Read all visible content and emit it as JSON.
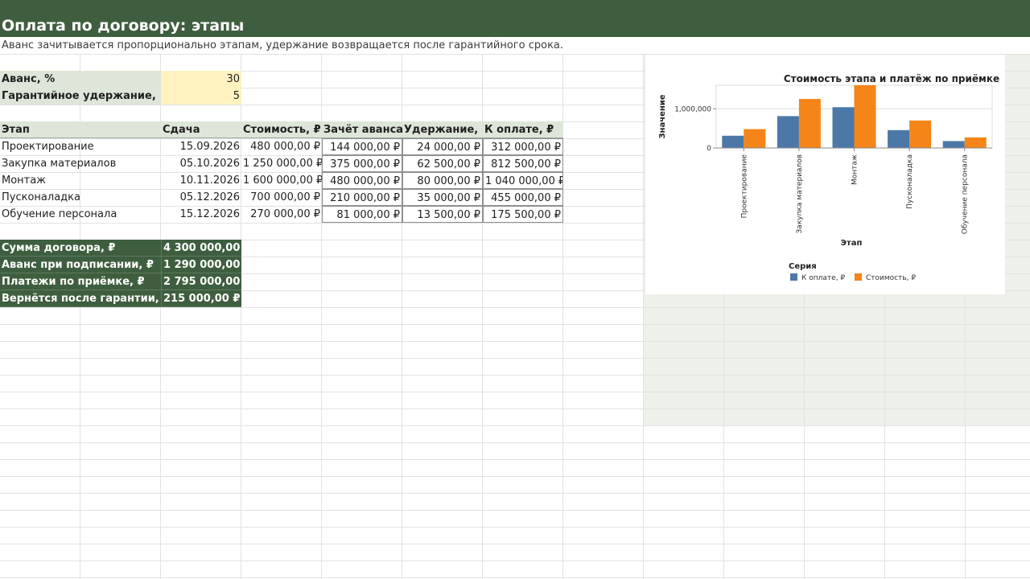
{
  "sheet": {
    "title": "Оплата по договору: этапы",
    "subtitle": "Аванс зачитывается пропорционально этапам, удержание возвращается после гарантийного срока."
  },
  "params": [
    {
      "label": "Аванс, %",
      "value": "30"
    },
    {
      "label": "Гарантийное удержание,",
      "value": "5"
    }
  ],
  "table": {
    "headers": [
      "Этап",
      "Сдача",
      "Стоимость, ₽",
      "Зачёт аванса",
      "Удержание,",
      "К оплате, ₽"
    ],
    "rows": [
      [
        "Проектирование",
        "15.09.2026",
        "480 000,00 ₽",
        "144 000,00 ₽",
        "24 000,00 ₽",
        "312 000,00 ₽"
      ],
      [
        "Закупка материалов",
        "05.10.2026",
        "1 250 000,00 ₽",
        "375 000,00 ₽",
        "62 500,00 ₽",
        "812 500,00 ₽"
      ],
      [
        "Монтаж",
        "10.11.2026",
        "1 600 000,00 ₽",
        "480 000,00 ₽",
        "80 000,00 ₽",
        "1 040 000,00 ₽"
      ],
      [
        "Пусконаладка",
        "05.12.2026",
        "700 000,00 ₽",
        "210 000,00 ₽",
        "35 000,00 ₽",
        "455 000,00 ₽"
      ],
      [
        "Обучение персонала",
        "15.12.2026",
        "270 000,00 ₽",
        "81 000,00 ₽",
        "13 500,00 ₽",
        "175 500,00 ₽"
      ]
    ]
  },
  "summary": [
    {
      "label": "Сумма договора, ₽",
      "value": "4 300 000,00 ₽"
    },
    {
      "label": "Аванс при подписании, ₽",
      "value": "1 290 000,00 ₽"
    },
    {
      "label": "Платежи по приёмке, ₽",
      "value": "2 795 000,00 ₽"
    },
    {
      "label": "Вернётся после гарантии,",
      "value": "215 000,00 ₽"
    }
  ],
  "colors": {
    "header_bar": "#3f5e3f",
    "param_label_bg": "#dde6d8",
    "param_value_bg": "#fff2c0",
    "series_blue": "#4c78a8",
    "series_orange": "#f58518"
  },
  "chart_data": {
    "type": "bar",
    "title": "Стоимость этапа и платёж по приёмке",
    "xlabel": "Этап",
    "ylabel": "Значение",
    "categories": [
      "Проектирование",
      "Закупка материалов",
      "Монтаж",
      "Пусконаладка",
      "Обучение персонала"
    ],
    "series": [
      {
        "name": "К оплате, ₽",
        "color": "#4c78a8",
        "values": [
          312000,
          812500,
          1040000,
          455000,
          175500
        ]
      },
      {
        "name": "Стоимость, ₽",
        "color": "#f58518",
        "values": [
          480000,
          1250000,
          1600000,
          700000,
          270000
        ]
      }
    ],
    "yticks": [
      {
        "value": 0,
        "label": "0"
      },
      {
        "value": 1000000,
        "label": "1,000,000"
      }
    ],
    "ylim": [
      0,
      1600000
    ],
    "legend_title": "Серия",
    "legend_position": "bottom",
    "grid": true
  }
}
